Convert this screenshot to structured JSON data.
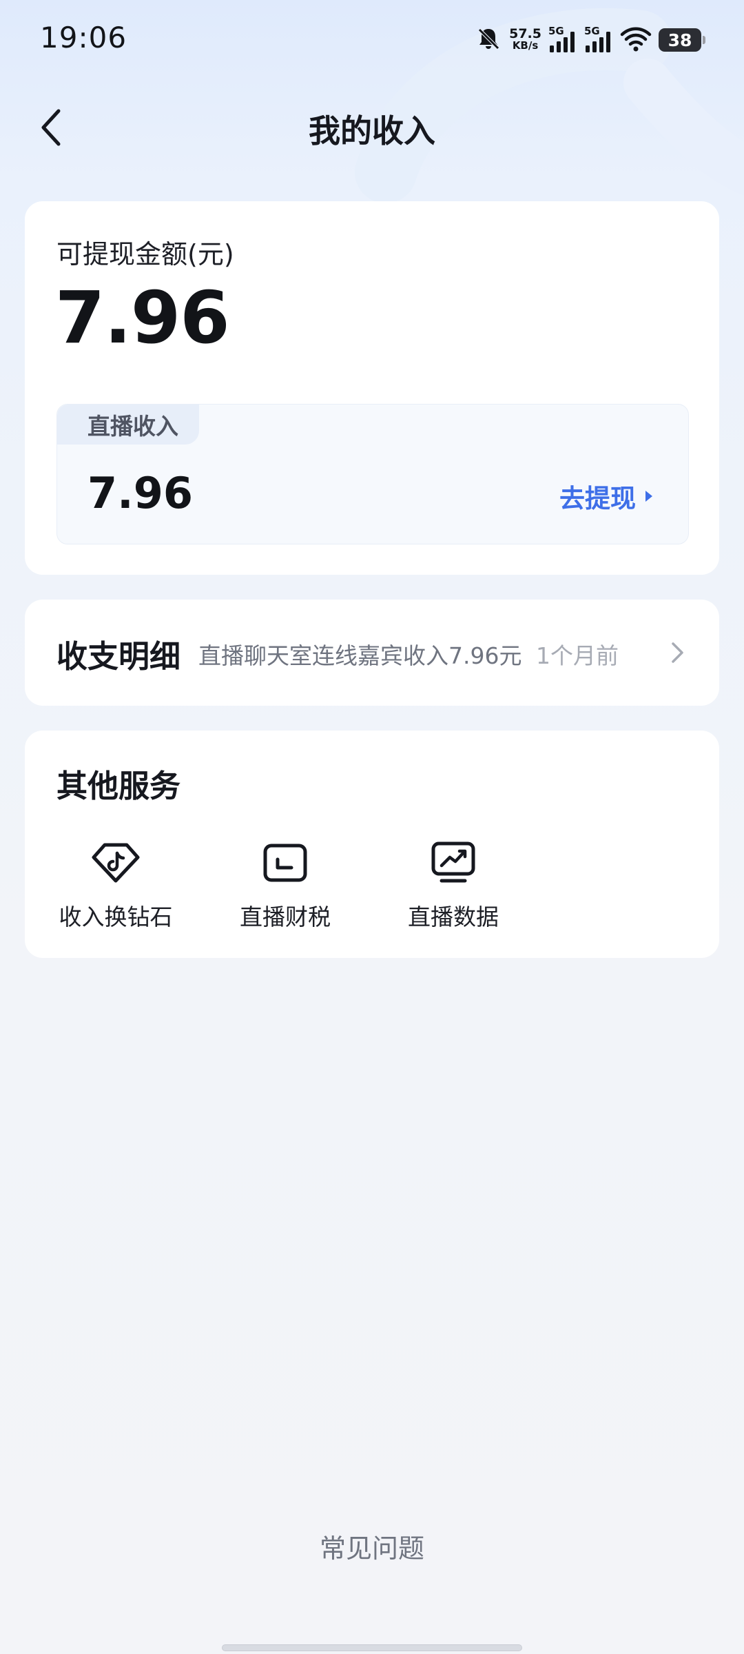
{
  "status_bar": {
    "time": "19:06",
    "net_speed_value": "57.5",
    "net_speed_unit": "KB/s",
    "signal_1_label": "5G",
    "signal_2_label": "5G",
    "battery_level": "38",
    "icons": [
      "bell-muted-icon",
      "signal-icon",
      "signal-icon",
      "wifi-icon",
      "battery-icon"
    ]
  },
  "nav": {
    "back_icon": "chevron-left-icon",
    "title": "我的收入"
  },
  "balance": {
    "label": "可提现金额(元)",
    "amount": "7.96",
    "live": {
      "tab_label": "直播收入",
      "amount": "7.96",
      "withdraw_label": "去提现",
      "withdraw_icon": "triangle-right-icon"
    }
  },
  "detail": {
    "title": "收支明细",
    "description": "直播聊天室连线嘉宾收入7.96元",
    "time": "1个月前",
    "chevron_icon": "chevron-right-icon"
  },
  "services": {
    "title": "其他服务",
    "items": [
      {
        "label": "收入换钻石",
        "icon": "diamond-icon"
      },
      {
        "label": "直播财税",
        "icon": "tax-screen-icon"
      },
      {
        "label": "直播数据",
        "icon": "chart-screen-icon"
      }
    ]
  },
  "footer": {
    "faq_label": "常见问题"
  },
  "colors": {
    "accent": "#3e6fe8",
    "text_primary": "#16181f",
    "text_secondary": "#6f7480",
    "card_bg": "#ffffff"
  }
}
